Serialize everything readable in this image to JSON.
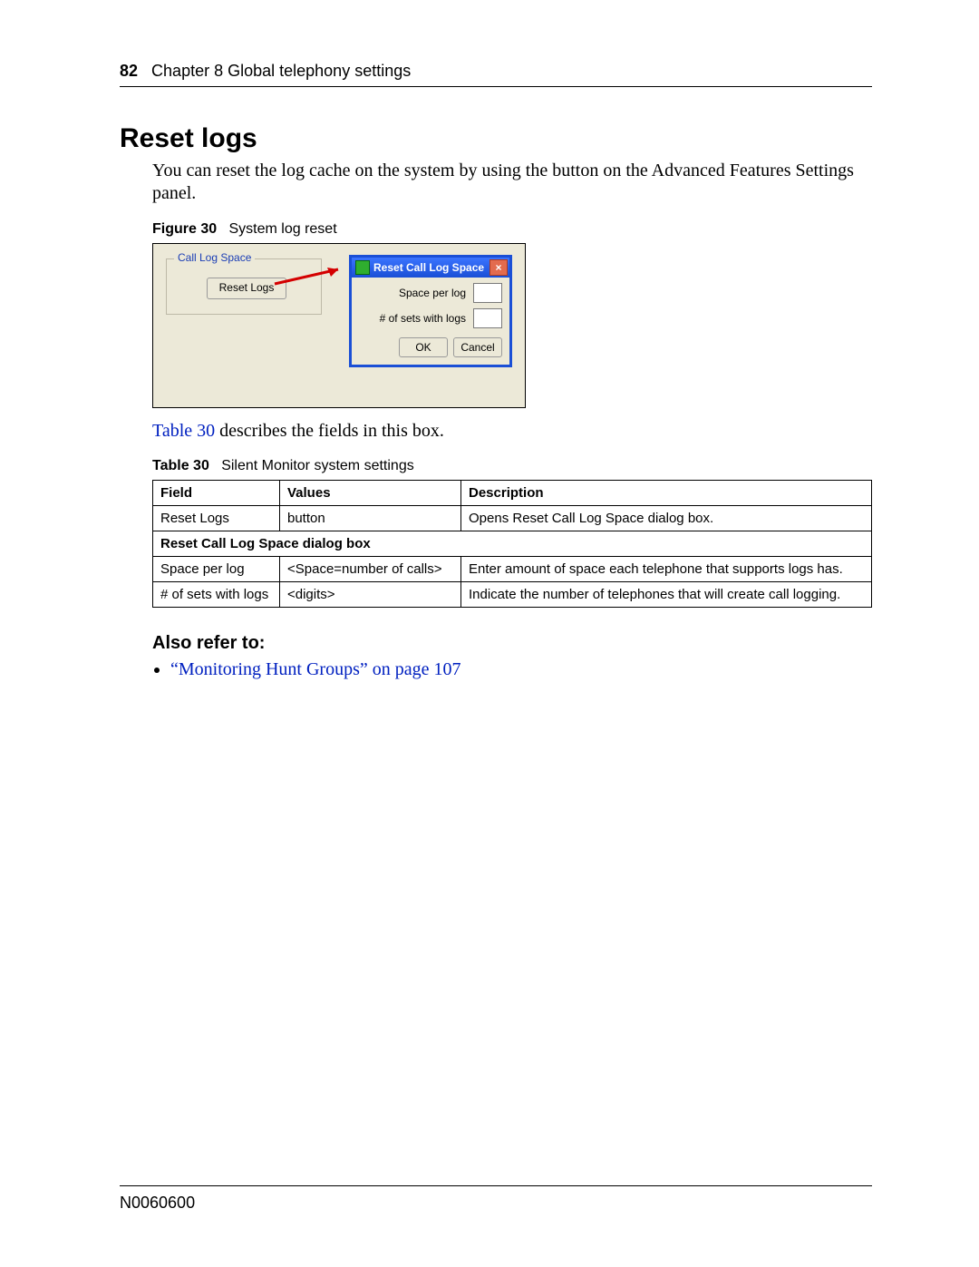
{
  "header": {
    "page_number": "82",
    "chapter": "Chapter 8  Global telephony settings"
  },
  "section": {
    "title": "Reset logs",
    "intro": "You can reset the log cache on the system by using the button on the Advanced Features Settings panel."
  },
  "figure": {
    "label": "Figure 30",
    "caption": "System log reset",
    "groupbox_title": "Call Log Space",
    "reset_button": "Reset Logs",
    "dialog": {
      "title": "Reset Call Log Space",
      "field1_label": "Space per log",
      "field1_value": "",
      "field2_label": "# of sets with logs",
      "field2_value": "",
      "ok": "OK",
      "cancel": "Cancel"
    }
  },
  "after_figure": {
    "link_text": "Table 30",
    "rest": " describes the fields in this box."
  },
  "table": {
    "label": "Table 30",
    "caption": "Silent Monitor system settings",
    "headers": [
      "Field",
      "Values",
      "Description"
    ],
    "rows": [
      {
        "cells": [
          "Reset Logs",
          "button",
          "Opens Reset Call Log Space dialog box."
        ]
      },
      {
        "span": true,
        "text": "Reset Call Log Space dialog box"
      },
      {
        "cells": [
          "Space per log",
          "<Space=number of calls>",
          "Enter amount of space each telephone that supports logs has."
        ]
      },
      {
        "cells": [
          "# of sets with logs",
          "<digits>",
          "Indicate the number of telephones that will create call logging."
        ]
      }
    ]
  },
  "also_refer": {
    "heading": "Also refer to:",
    "items": [
      "“Monitoring Hunt Groups” on page 107"
    ]
  },
  "footer": {
    "doc_id": "N0060600"
  }
}
